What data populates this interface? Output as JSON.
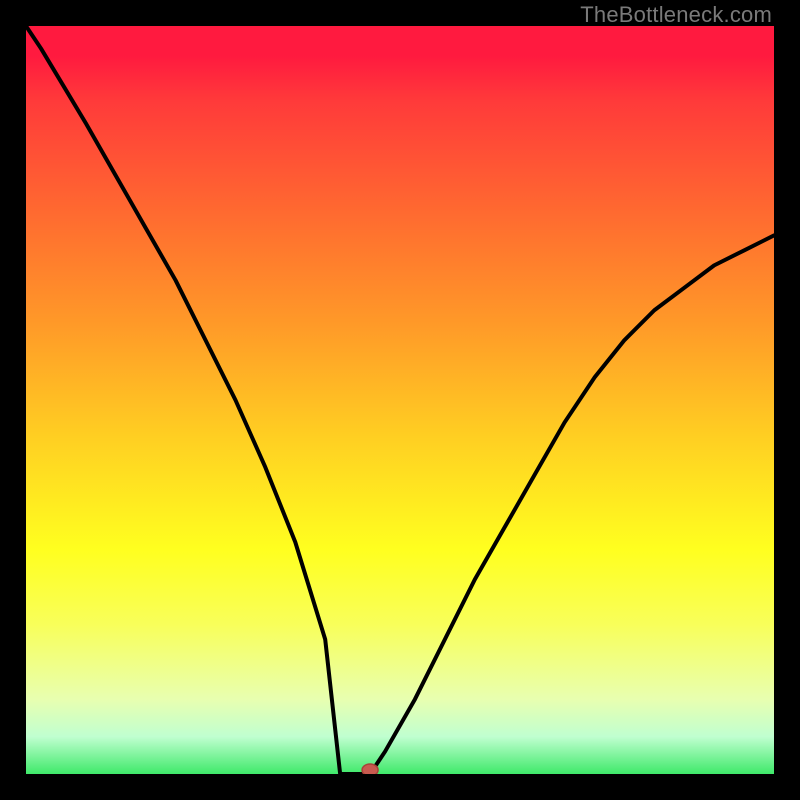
{
  "watermark": "TheBottleneck.com",
  "colors": {
    "background": "#000000",
    "curve": "#000000",
    "marker_fill": "#c85a4f",
    "marker_stroke": "#a84338",
    "gradient_stops": [
      {
        "pos": 0.0,
        "hex": "#ff1a3f"
      },
      {
        "pos": 0.1,
        "hex": "#ff3a3a"
      },
      {
        "pos": 0.25,
        "hex": "#ff6a30"
      },
      {
        "pos": 0.4,
        "hex": "#ff9a28"
      },
      {
        "pos": 0.55,
        "hex": "#ffcf22"
      },
      {
        "pos": 0.7,
        "hex": "#ffff1f"
      },
      {
        "pos": 0.8,
        "hex": "#f8ff5a"
      },
      {
        "pos": 0.9,
        "hex": "#e8ffb0"
      },
      {
        "pos": 0.95,
        "hex": "#c0ffd0"
      },
      {
        "pos": 1.0,
        "hex": "#3fe96a"
      }
    ]
  },
  "chart_data": {
    "type": "line",
    "title": "",
    "xlabel": "",
    "ylabel": "",
    "xlim": [
      0,
      100
    ],
    "ylim": [
      0,
      100
    ],
    "marker": {
      "x": 46,
      "y": 0
    },
    "flat_segment": {
      "x_start": 42,
      "x_end": 46,
      "y": 0
    },
    "series": [
      {
        "name": "curve",
        "x": [
          0,
          2,
          5,
          8,
          12,
          16,
          20,
          24,
          28,
          32,
          36,
          40,
          42,
          46,
          48,
          52,
          56,
          60,
          64,
          68,
          72,
          76,
          80,
          84,
          88,
          92,
          96,
          100
        ],
        "y": [
          100,
          97,
          92,
          87,
          80,
          73,
          66,
          58,
          50,
          41,
          31,
          18,
          0,
          0,
          3,
          10,
          18,
          26,
          33,
          40,
          47,
          53,
          58,
          62,
          65,
          68,
          70,
          72
        ]
      }
    ]
  }
}
